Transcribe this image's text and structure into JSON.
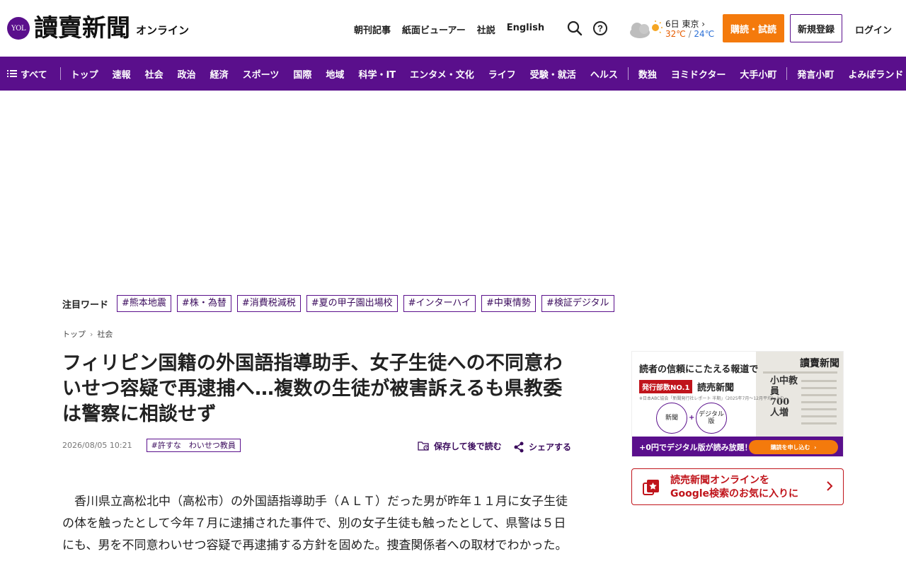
{
  "header": {
    "logo_badge": "YOL",
    "logo_text": "讀賣新聞",
    "logo_sub": "オンライン",
    "nav": [
      "朝刊記事",
      "紙面ビューアー",
      "社説",
      "English"
    ],
    "weather": {
      "date": "6日 東京",
      "high": "32℃",
      "sep": " / ",
      "low": "24℃"
    },
    "subscribe": "購読・試読",
    "register": "新規登録",
    "login": "ログイン"
  },
  "category_nav": {
    "all": "すべて",
    "items": [
      "トップ",
      "速報",
      "社会",
      "政治",
      "経済",
      "スポーツ",
      "国際",
      "地域",
      "科学・IT",
      "エンタメ・文化",
      "ライフ",
      "受験・就活",
      "ヘルス"
    ],
    "extra": [
      "数独",
      "ヨミドクター",
      "大手小町"
    ],
    "extra2": [
      "発言小町",
      "よみぽランド"
    ]
  },
  "trending": {
    "label": "注目ワード",
    "tags": [
      "#熊本地震",
      "#株・為替",
      "#消費税減税",
      "#夏の甲子園出場校",
      "#インターハイ",
      "#中東情勢",
      "#検証デジタル"
    ]
  },
  "breadcrumb": [
    "トップ",
    "社会"
  ],
  "article": {
    "title": "フィリピン国籍の外国語指導助手、女子生徒への不同意わいせつ容疑で再逮捕へ…複数の生徒が被害訴えるも県教委は警察に相談せず",
    "date": "2026/08/05 10:21",
    "tag": "#許すな　わいせつ教員",
    "save": "保存して後で読む",
    "share": "シェアする",
    "body": "香川県立高松北中（高松市）の外国語指導助手（ＡＬＴ）だった男が昨年１１月に女子生徒の体を触ったとして今年７月に逮捕された事件で、別の女子生徒も触ったとして、県警は５日にも、男を不同意わいせつ容疑で再逮捕する方針を固めた。捜査関係者への取材でわかった。"
  },
  "sidebar": {
    "ad": {
      "headline": "読者の信頼にこたえる報道で",
      "badge": "発行部数NO.1",
      "badge_suffix": "読売新聞",
      "fine": "※日本ABC協会「新聞発行社レポート 半期」（2025年7月〜12月平均）より",
      "circle1": "新聞",
      "plus": "+",
      "circle2": "デジタル版",
      "paper_title": "讀賣新聞",
      "paper_text": "小中教員700人増",
      "bar_text": "+0円でデジタル版が読み放題！",
      "bar_button": "購読を申し込む"
    },
    "google": {
      "line1": "読売新聞オンラインを",
      "line2": "Google検索のお気に入りに"
    }
  },
  "colors": {
    "brand_purple": "#5a0f8c",
    "accent_orange": "#f47a0c",
    "red": "#c0141b"
  }
}
